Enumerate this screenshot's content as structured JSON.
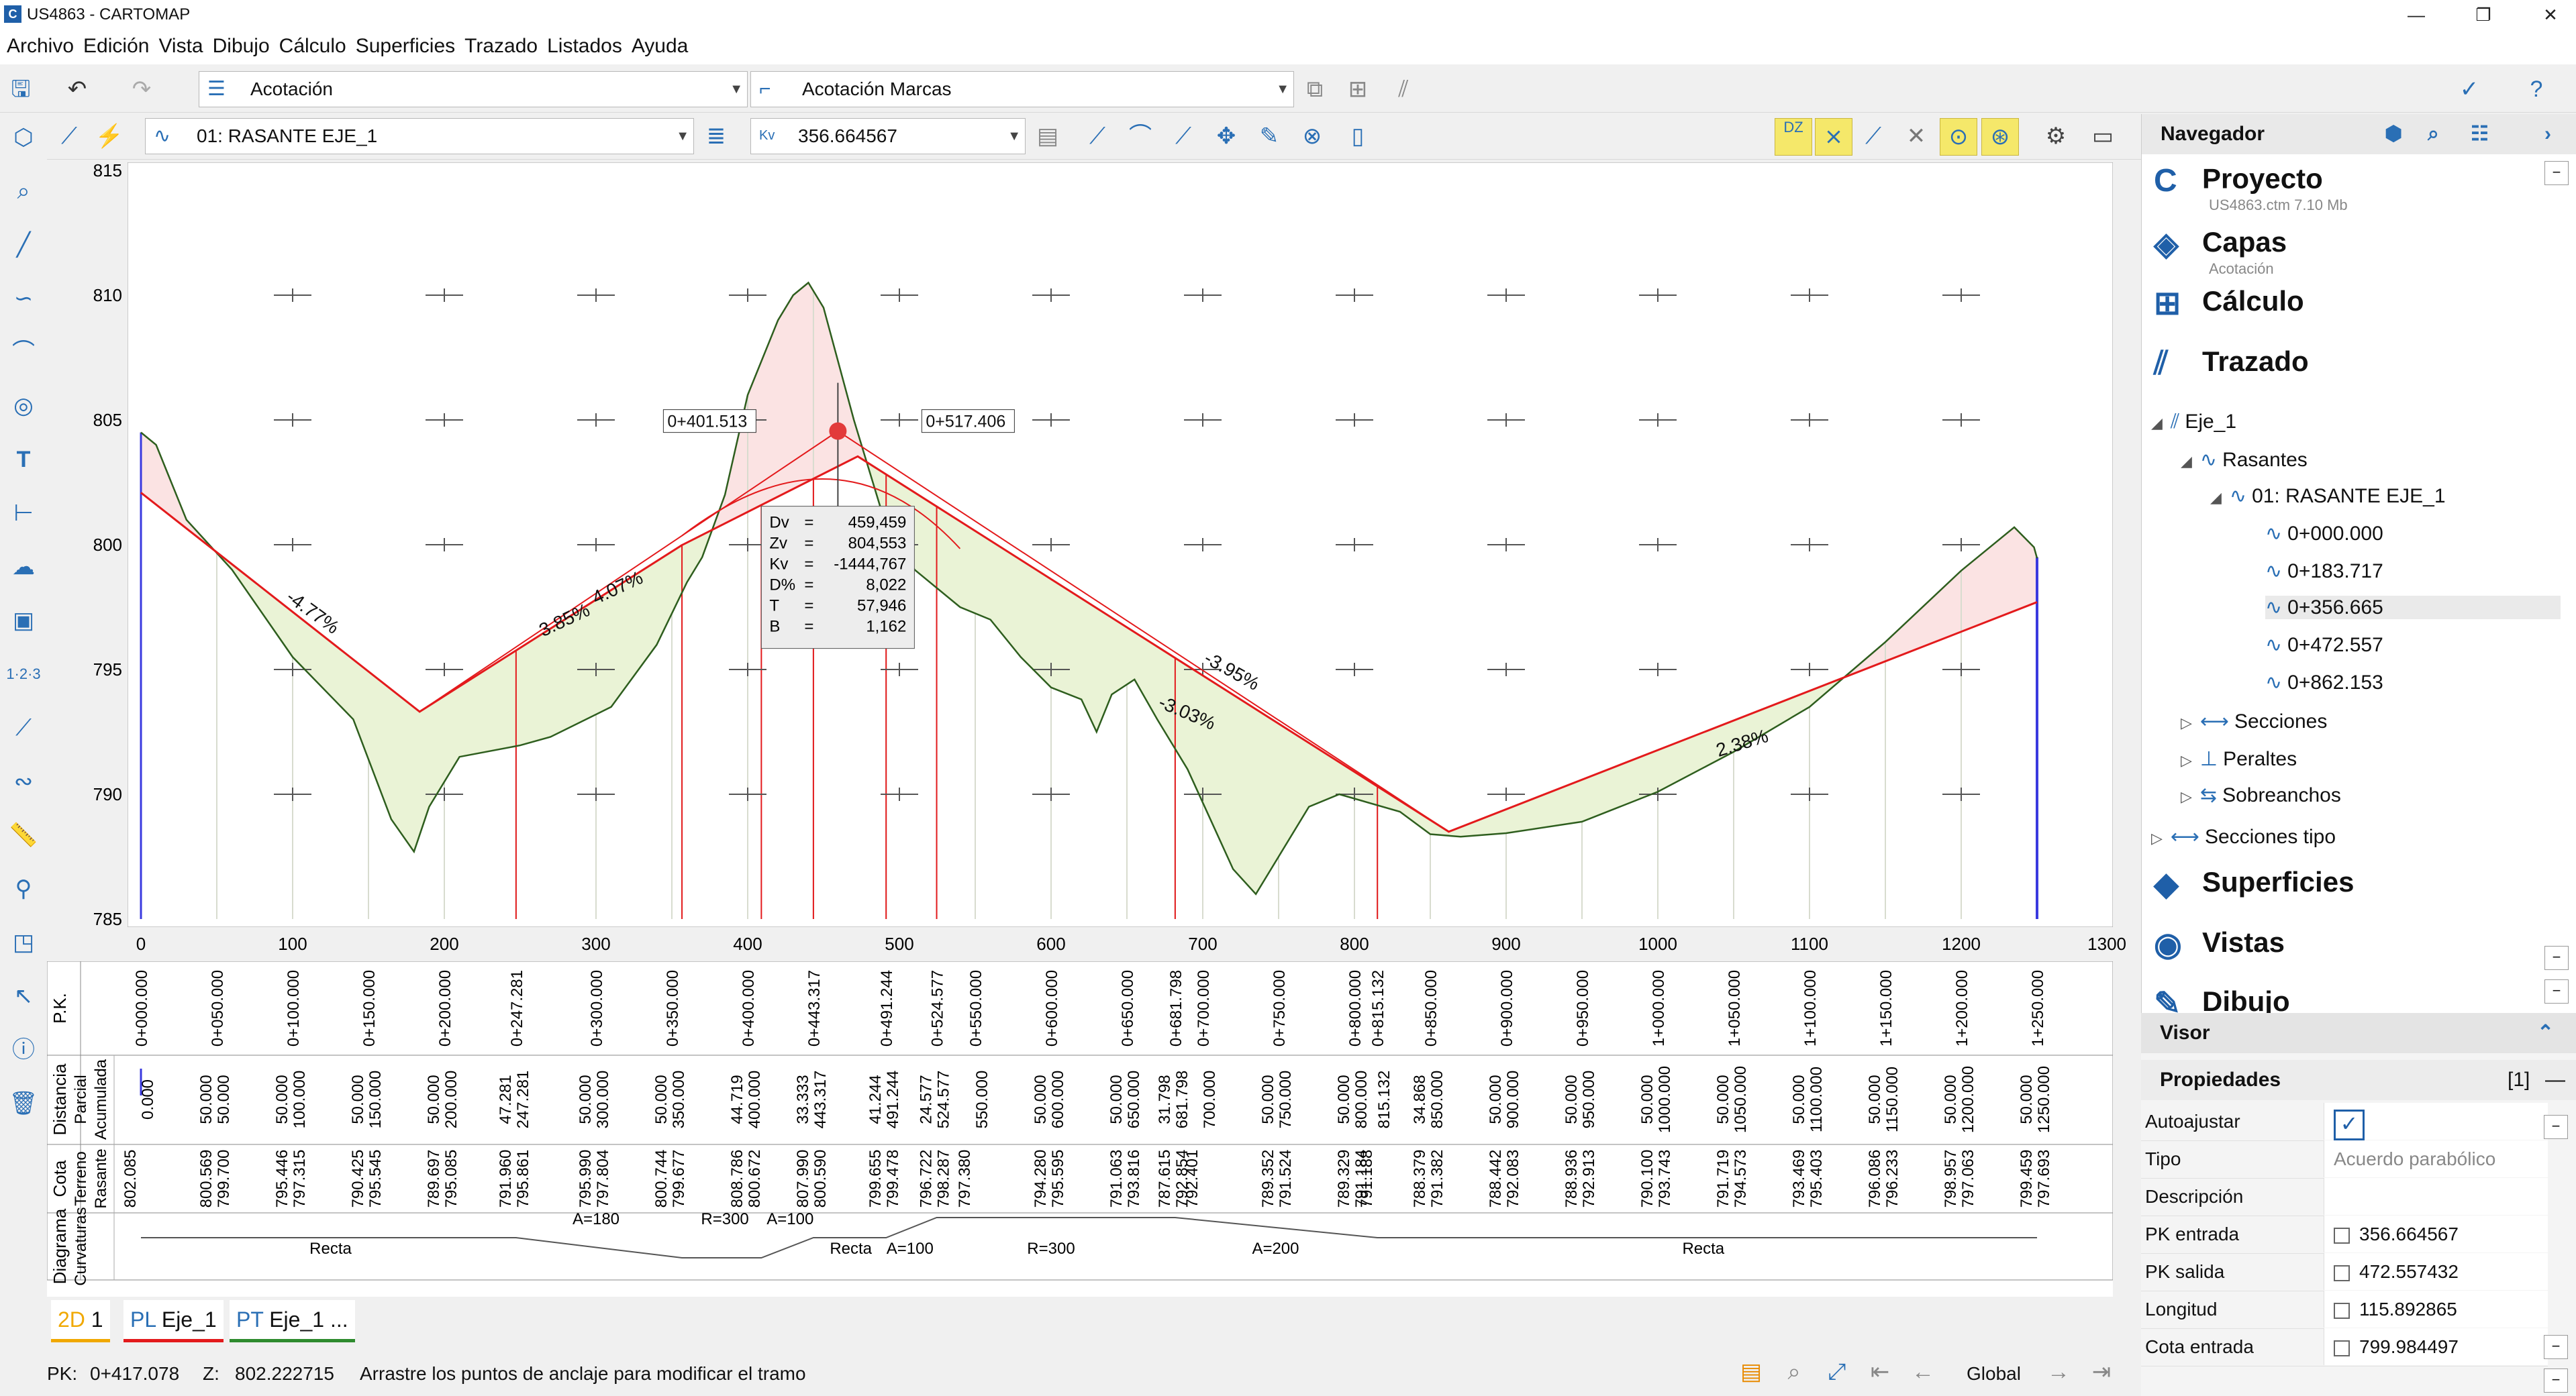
{
  "window": {
    "title": "US4863 - CARTOMAP",
    "logo": "C",
    "min": "—",
    "restore": "❐",
    "close": "✕"
  },
  "menu": [
    "Archivo",
    "Edición",
    "Vista",
    "Dibujo",
    "Cálculo",
    "Superficies",
    "Trazado",
    "Listados",
    "Ayuda"
  ],
  "toolbar": {
    "layer_combo": "Acotación",
    "style_combo": "Acotación Marcas"
  },
  "toolbar2": {
    "alignment_combo": "01: RASANTE EJE_1",
    "kv_label": "Kv",
    "kv_value": "356.664567",
    "dz_label": "DZ"
  },
  "chart_data": {
    "type": "line",
    "xlim": [
      0,
      1300
    ],
    "ylim": [
      785,
      815
    ],
    "x_ticks": [
      "0",
      "100",
      "200",
      "300",
      "400",
      "500",
      "600",
      "700",
      "800",
      "900",
      "1000",
      "1100",
      "1200",
      "1300"
    ],
    "y_ticks": [
      "815",
      "810",
      "805",
      "800",
      "795",
      "790",
      "785"
    ],
    "series": [
      {
        "role": "terreno",
        "color": "#2e5e1e",
        "points": [
          [
            0,
            804.5
          ],
          [
            10,
            804
          ],
          [
            30,
            801
          ],
          [
            60,
            799
          ],
          [
            100,
            795.5
          ],
          [
            140,
            793
          ],
          [
            165,
            789
          ],
          [
            180,
            787.7
          ],
          [
            190,
            789.5
          ],
          [
            210,
            791.5
          ],
          [
            250,
            791.96
          ],
          [
            270,
            792.3
          ],
          [
            310,
            793.5
          ],
          [
            340,
            795.99
          ],
          [
            360,
            798.5
          ],
          [
            370,
            799.5
          ],
          [
            385,
            802
          ],
          [
            400,
            806
          ],
          [
            420,
            809
          ],
          [
            430,
            810
          ],
          [
            440,
            810.5
          ],
          [
            450,
            809.5
          ],
          [
            470,
            805
          ],
          [
            490,
            801
          ],
          [
            510,
            799
          ],
          [
            540,
            797.5
          ],
          [
            560,
            797
          ],
          [
            580,
            795.5
          ],
          [
            600,
            794.28
          ],
          [
            620,
            793.8
          ],
          [
            630,
            792.5
          ],
          [
            640,
            794
          ],
          [
            655,
            794.6
          ],
          [
            670,
            793
          ],
          [
            690,
            791
          ],
          [
            720,
            787
          ],
          [
            735,
            786
          ],
          [
            745,
            787
          ],
          [
            770,
            789.5
          ],
          [
            790,
            790
          ],
          [
            830,
            789.3
          ],
          [
            850,
            788.4
          ],
          [
            870,
            788.3
          ],
          [
            900,
            788.44
          ],
          [
            950,
            788.9
          ],
          [
            1000,
            790.1
          ],
          [
            1050,
            791.7
          ],
          [
            1100,
            793.5
          ],
          [
            1150,
            796.1
          ],
          [
            1200,
            798.96
          ],
          [
            1235,
            800.7
          ],
          [
            1248,
            799.9
          ],
          [
            1250,
            799.46
          ]
        ]
      },
      {
        "role": "rasante",
        "color": "#e31a1c",
        "points": [
          [
            0,
            802.085
          ],
          [
            183.717,
            793.309
          ],
          [
            356.665,
            799.984
          ],
          [
            472.557,
            803.54
          ],
          [
            862.153,
            788.5
          ],
          [
            1250,
            797.7
          ]
        ]
      },
      {
        "role": "tangente",
        "color": "#e31a1c",
        "points": [
          [
            183.717,
            793.309
          ],
          [
            459.459,
            804.553
          ],
          [
            862.153,
            788.5
          ]
        ]
      }
    ],
    "grade_labels": [
      {
        "text": "-4.77%",
        "x": 95,
        "y": 797.8,
        "angle": 36
      },
      {
        "text": "3.85%",
        "x": 265,
        "y": 796.3,
        "angle": -25
      },
      {
        "text": "4.07%",
        "x": 300,
        "y": 797.6,
        "angle": -25
      },
      {
        "text": "-3.95%",
        "x": 700,
        "y": 795.3,
        "angle": 29
      },
      {
        "text": "-3.03%",
        "x": 670,
        "y": 793.5,
        "angle": 23
      },
      {
        "text": "2.38%",
        "x": 1040,
        "y": 791.5,
        "angle": -17
      }
    ],
    "vertex": {
      "x": 459.459,
      "y": 804.553
    },
    "vertex_labels": [
      "0+401.513",
      "0+517.406"
    ],
    "info_box": [
      [
        "Dv",
        "=",
        "459,459"
      ],
      [
        "Zv",
        "=",
        "804,553"
      ],
      [
        "Kv",
        "=",
        "-1444,767"
      ],
      [
        "D%",
        "=",
        "8,022"
      ],
      [
        "T",
        "=",
        "57,946"
      ],
      [
        "B",
        "=",
        "1,162"
      ]
    ]
  },
  "bands": {
    "row_labels": {
      "pk": "P.K.",
      "distancia": "Distancia",
      "parcial": "Parcial",
      "acumulada": "Acumulada",
      "cota": "Cota",
      "terreno": "Terreno",
      "rasante": "Rasante",
      "diagrama": "Diagrama",
      "curvaturas": "Curvaturas"
    },
    "columns": [
      {
        "x": 0,
        "pk": "0+000.000",
        "parcial": "",
        "acum": "0.000",
        "terreno": "802.085",
        "rasante": ""
      },
      {
        "x": 50,
        "pk": "0+050.000",
        "parcial": "50.000",
        "acum": "50.000",
        "terreno": "800.569",
        "rasante": "799.700"
      },
      {
        "x": 100,
        "pk": "0+100.000",
        "parcial": "50.000",
        "acum": "100.000",
        "terreno": "795.446",
        "rasante": "797.315"
      },
      {
        "x": 150,
        "pk": "0+150.000",
        "parcial": "50.000",
        "acum": "150.000",
        "terreno": "790.425",
        "rasante": "795.545"
      },
      {
        "x": 200,
        "pk": "0+200.000",
        "parcial": "50.000",
        "acum": "200.000",
        "terreno": "789.697",
        "rasante": "795.085"
      },
      {
        "x": 247.281,
        "pk": "0+247.281",
        "parcial": "47.281",
        "acum": "247.281",
        "terreno": "791.960",
        "rasante": "795.861"
      },
      {
        "x": 300,
        "pk": "0+300.000",
        "parcial": "50.000",
        "acum": "300.000",
        "terreno": "795.990",
        "rasante": "797.804"
      },
      {
        "x": 350,
        "pk": "0+350.000",
        "parcial": "50.000",
        "acum": "350.000",
        "terreno": "800.744",
        "rasante": "799.677"
      },
      {
        "x": 400,
        "pk": "0+400.000",
        "parcial": "44.719",
        "acum": "400.000",
        "terreno": "808.786",
        "rasante": "800.672"
      },
      {
        "x": 443.317,
        "pk": "0+443.317",
        "parcial": "33.333",
        "acum": "443.317",
        "terreno": "807.990",
        "rasante": "800.590"
      },
      {
        "x": 491.244,
        "pk": "0+491.244",
        "parcial": "41.244",
        "acum": "491.244",
        "terreno": "799.655",
        "rasante": "799.478"
      },
      {
        "x": 524.577,
        "pk": "0+524.577",
        "parcial": "24.577",
        "acum": "524.577",
        "terreno": "796.722",
        "rasante": "798.287"
      },
      {
        "x": 550,
        "pk": "0+550.000",
        "parcial": "",
        "acum": "550.000",
        "terreno": "797.380",
        "rasante": ""
      },
      {
        "x": 600,
        "pk": "0+600.000",
        "parcial": "50.000",
        "acum": "600.000",
        "terreno": "794.280",
        "rasante": "795.595"
      },
      {
        "x": 650,
        "pk": "0+650.000",
        "parcial": "50.000",
        "acum": "650.000",
        "terreno": "791.063",
        "rasante": "793.816"
      },
      {
        "x": 681.798,
        "pk": "0+681.798",
        "parcial": "31.798",
        "acum": "681.798",
        "terreno": "787.615",
        "rasante": "792.854"
      },
      {
        "x": 700,
        "pk": "0+700.000",
        "parcial": "",
        "acum": "700.000",
        "terreno": "792.401",
        "rasante": ""
      },
      {
        "x": 750,
        "pk": "0+750.000",
        "parcial": "50.000",
        "acum": "750.000",
        "terreno": "789.352",
        "rasante": "791.524"
      },
      {
        "x": 800,
        "pk": "0+800.000",
        "parcial": "50.000",
        "acum": "800.000",
        "terreno": "789.329",
        "rasante": "791.184"
      },
      {
        "x": 815.132,
        "pk": "0+815.132",
        "parcial": "",
        "acum": "815.132",
        "terreno": "791.188",
        "rasante": ""
      },
      {
        "x": 850,
        "pk": "0+850.000",
        "parcial": "34.868",
        "acum": "850.000",
        "terreno": "788.379",
        "rasante": "791.382"
      },
      {
        "x": 900,
        "pk": "0+900.000",
        "parcial": "50.000",
        "acum": "900.000",
        "terreno": "788.442",
        "rasante": "792.083"
      },
      {
        "x": 950,
        "pk": "0+950.000",
        "parcial": "50.000",
        "acum": "950.000",
        "terreno": "788.936",
        "rasante": "792.913"
      },
      {
        "x": 1000,
        "pk": "1+000.000",
        "parcial": "50.000",
        "acum": "1000.000",
        "terreno": "790.100",
        "rasante": "793.743"
      },
      {
        "x": 1050,
        "pk": "1+050.000",
        "parcial": "50.000",
        "acum": "1050.000",
        "terreno": "791.719",
        "rasante": "794.573"
      },
      {
        "x": 1100,
        "pk": "1+100.000",
        "parcial": "50.000",
        "acum": "1100.000",
        "terreno": "793.469",
        "rasante": "795.403"
      },
      {
        "x": 1150,
        "pk": "1+150.000",
        "parcial": "50.000",
        "acum": "1150.000",
        "terreno": "796.086",
        "rasante": "796.233"
      },
      {
        "x": 1200,
        "pk": "1+200.000",
        "parcial": "50.000",
        "acum": "1200.000",
        "terreno": "798.957",
        "rasante": "797.063"
      },
      {
        "x": 1250,
        "pk": "1+250.000",
        "parcial": "50.000",
        "acum": "1250.000",
        "terreno": "799.459",
        "rasante": "797.693"
      }
    ],
    "diagram_labels": [
      {
        "text": "A=180",
        "x": 300
      },
      {
        "text": "R=300",
        "x": 385
      },
      {
        "text": "A=100",
        "x": 428
      },
      {
        "text": "A=100",
        "x": 507
      },
      {
        "text": "R=300",
        "x": 600
      },
      {
        "text": "A=200",
        "x": 748
      }
    ],
    "recta_labels": [
      {
        "text": "Recta",
        "x": 125
      },
      {
        "text": "Recta",
        "x": 468
      },
      {
        "text": "Recta",
        "x": 1030
      }
    ]
  },
  "tabs": [
    {
      "prefix": "2D",
      "label": "1",
      "color": "#f0a800"
    },
    {
      "prefix": "PL",
      "label": "Eje_1",
      "color": "#e31a1c"
    },
    {
      "prefix": "PT",
      "label": "Eje_1 ...",
      "color": "#2e8b2e"
    }
  ],
  "status": {
    "pk_label": "PK:",
    "pk_value": "0+417.078",
    "z_label": "Z:",
    "z_value": "802.222715",
    "hint": "Arrastre los puntos de anclaje para modificar el tramo",
    "scope": "Global"
  },
  "navigator": {
    "title": "Navegador",
    "project": {
      "label": "Proyecto",
      "sub": "US4863.ctm 7.10 Mb"
    },
    "capas": {
      "label": "Capas",
      "sub": "Acotación"
    },
    "calculo": "Cálculo",
    "trazado": "Trazado",
    "eje": "Eje_1",
    "rasantes": "Rasantes",
    "rasante_item": "01: RASANTE EJE_1",
    "vertices": [
      "0+000.000",
      "0+183.717",
      "0+356.665",
      "0+472.557",
      "0+862.153"
    ],
    "secciones": "Secciones",
    "peraltes": "Peraltes",
    "sobreanchos": "Sobreanchos",
    "secciones_tipo": "Secciones tipo",
    "superficies": "Superficies",
    "vistas": "Vistas",
    "dibujo": "Dibujo"
  },
  "visor": {
    "title": "Visor"
  },
  "properties": {
    "title": "Propiedades",
    "count": "[1]",
    "rows": [
      {
        "name": "Autoajustar",
        "value": "",
        "type": "checkon"
      },
      {
        "name": "Tipo",
        "value": "Acuerdo parabólico",
        "type": "grey"
      },
      {
        "name": "Descripción",
        "value": "",
        "type": "text"
      },
      {
        "name": "PK entrada",
        "value": "356.664567",
        "type": "check"
      },
      {
        "name": "PK salida",
        "value": "472.557432",
        "type": "check"
      },
      {
        "name": "Longitud",
        "value": "115.892865",
        "type": "check"
      },
      {
        "name": "Cota entrada",
        "value": "799.984497",
        "type": "check"
      }
    ]
  }
}
